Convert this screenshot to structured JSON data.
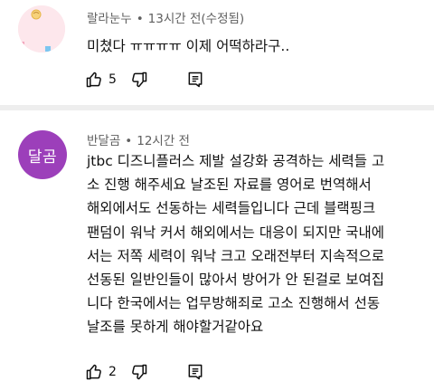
{
  "comments": [
    {
      "author": "랄라눈누",
      "separator": "•",
      "time": "13시간 전(수정됨)",
      "text_lines": [
        "미쳤다 ㅠㅠㅠㅠ 이제 어떡하라구.."
      ],
      "likes": "5",
      "avatar": {
        "type": "image",
        "color": "#fde7ec"
      }
    },
    {
      "author": "반달곰",
      "separator": "•",
      "time": "12시간 전",
      "text_lines": [
        "jtbc 디즈니플러스 제발 설강화 공격하는 세력들 고",
        "소 진행 해주세요  날조된 자료를 영어로 번역해서",
        "해외에서도 선동하는 세력들입니다 근데 블랙핑크",
        "팬덤이 워낙 커서 해외에서는 대응이 되지만 국내에",
        "서는 저쪽 세력이 워낙 크고 오래전부터 지속적으로",
        "선동된 일반인들이 많아서 방어가 안 된걸로 보여집",
        "니다 한국에서는 업무방해죄로 고소 진행해서 선동",
        "날조를 못하게 해야할거같아요"
      ],
      "likes": "2",
      "avatar": {
        "type": "initials",
        "text": "달곰",
        "color": "#9c3fba"
      }
    }
  ],
  "icons": {
    "like": "thumbs-up-icon",
    "dislike": "thumbs-down-icon",
    "reply": "reply-icon"
  }
}
